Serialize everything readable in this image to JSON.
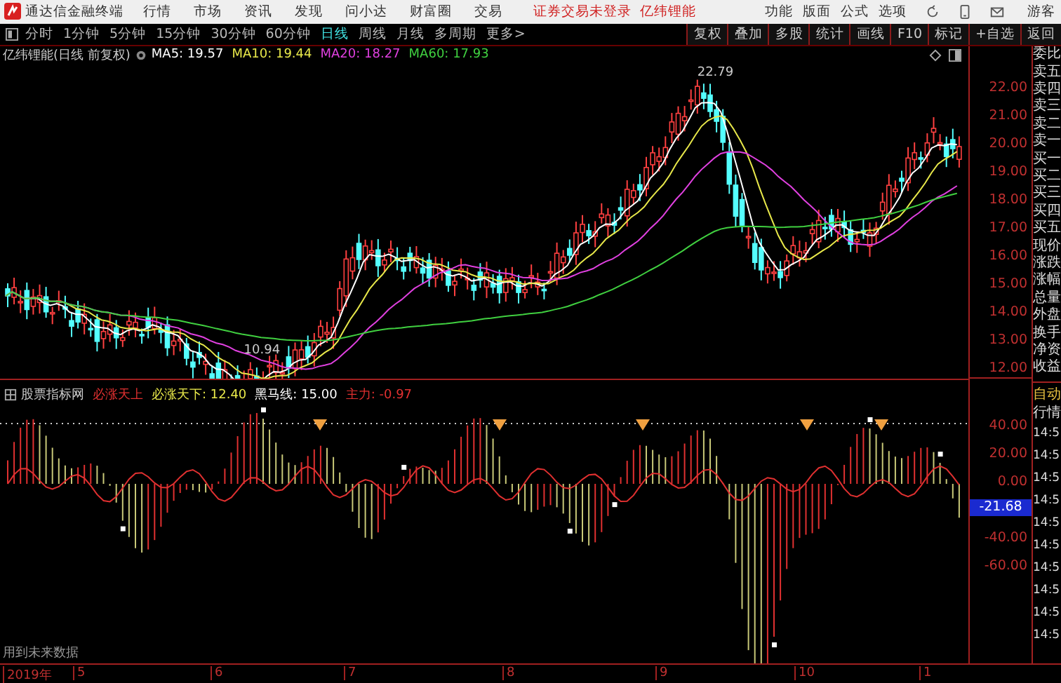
{
  "app": {
    "name": "通达信金融终端"
  },
  "menu": [
    "行情",
    "市场",
    "资讯",
    "发现",
    "问小达",
    "财富圈",
    "交易"
  ],
  "notices": [
    "证券交易未登录",
    "亿纬锂能"
  ],
  "tools_menu": [
    "功能",
    "版面",
    "公式",
    "选项"
  ],
  "user": "游客",
  "periods": [
    {
      "label": "分时",
      "selected": false
    },
    {
      "label": "1分钟",
      "selected": false
    },
    {
      "label": "5分钟",
      "selected": false
    },
    {
      "label": "15分钟",
      "selected": false
    },
    {
      "label": "30分钟",
      "selected": false
    },
    {
      "label": "60分钟",
      "selected": false
    },
    {
      "label": "日线",
      "selected": true
    },
    {
      "label": "周线",
      "selected": false
    },
    {
      "label": "月线",
      "selected": false
    },
    {
      "label": "多周期",
      "selected": false
    },
    {
      "label": "更多>",
      "selected": false
    }
  ],
  "chart_buttons": [
    "复权",
    "叠加",
    "多股",
    "统计",
    "画线",
    "F10",
    "标记",
    "+自选",
    "返回"
  ],
  "main_chart": {
    "title": "亿纬锂能(日线 前复权)",
    "ma": [
      {
        "label": "MA5: 19.57",
        "color": "#ffffff"
      },
      {
        "label": "MA10: 19.44",
        "color": "#e8e84a"
      },
      {
        "label": "MA20: 18.27",
        "color": "#e040e0"
      },
      {
        "label": "MA60: 17.93",
        "color": "#40d040"
      }
    ],
    "high_label": "22.79",
    "low_label": "10.94",
    "y_labels": [
      "22.00",
      "21.00",
      "20.00",
      "19.00",
      "18.00",
      "17.00",
      "16.00",
      "15.00",
      "14.00",
      "13.00",
      "12.00"
    ]
  },
  "indicator": {
    "source": "股票指标网",
    "name": "必涨天上",
    "values": [
      {
        "label": "必涨天下: 12.40",
        "color": "#e8e84a"
      },
      {
        "label": "黑马线: 15.00",
        "color": "#ffffff"
      },
      {
        "label": "主力: -0.97",
        "color": "#e03030"
      }
    ],
    "y_labels": [
      {
        "text": "40.00",
        "kind": "tick"
      },
      {
        "text": "20.00",
        "kind": "tick"
      },
      {
        "text": "0.00",
        "kind": "tick"
      },
      {
        "text": "-21.68",
        "kind": "current"
      },
      {
        "text": "-40.00",
        "kind": "tick"
      },
      {
        "text": "-60.00",
        "kind": "tick"
      }
    ],
    "note": "用到未来数据"
  },
  "x_axis": [
    "2019年",
    "5",
    "6",
    "7",
    "8",
    "9",
    "10",
    "1"
  ],
  "quote_panel": {
    "labels": [
      "委比",
      "卖五",
      "卖四",
      "卖三",
      "卖二",
      "卖一",
      "买一",
      "买二",
      "买三",
      "买四",
      "买五",
      "现价",
      "涨跌",
      "涨幅",
      "总量",
      "外盘",
      "换手",
      "净资",
      "收益"
    ],
    "auto": "自动",
    "market": "行情",
    "times": [
      "14:5",
      "14:5",
      "14:5",
      "14:5",
      "14:5",
      "14:5",
      "14:5",
      "14:5",
      "14:5",
      "14:5"
    ]
  }
}
